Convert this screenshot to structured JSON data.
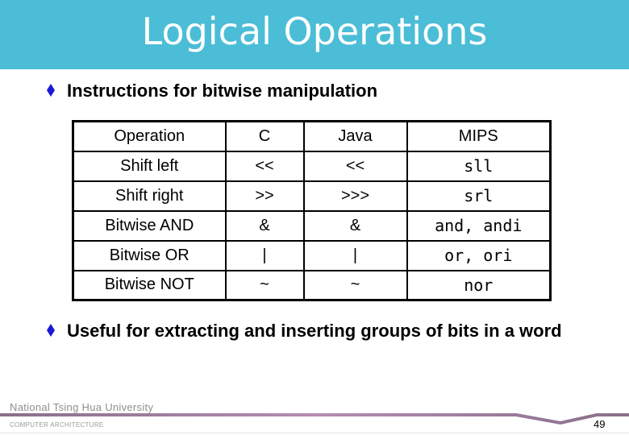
{
  "slide": {
    "title": "Logical Operations",
    "colors": {
      "title_bar": "#4bbdd6",
      "title_text": "#ffffff",
      "bullet": "#1a1ad6",
      "footer_accent": "#9a7598"
    }
  },
  "bullets": [
    {
      "icon": "diamond-bullet-icon",
      "text": "Instructions for bitwise manipulation"
    },
    {
      "icon": "diamond-bullet-icon",
      "text": "Useful for extracting and inserting groups of bits in a word"
    }
  ],
  "table": {
    "headers": [
      "Operation",
      "C",
      "Java",
      "MIPS"
    ],
    "rows": [
      [
        "Shift left",
        "<<",
        "<<",
        "sll"
      ],
      [
        "Shift right",
        ">>",
        ">>>",
        "srl"
      ],
      [
        "Bitwise AND",
        "&",
        "&",
        "and, andi"
      ],
      [
        "Bitwise OR",
        "|",
        "|",
        "or, ori"
      ],
      [
        "Bitwise NOT",
        "~",
        "~",
        "nor"
      ]
    ]
  },
  "footer": {
    "institution": "National  Tsing  Hua  University",
    "course": "COMPUTER   ARCHITECTURE",
    "page_number": "49"
  }
}
